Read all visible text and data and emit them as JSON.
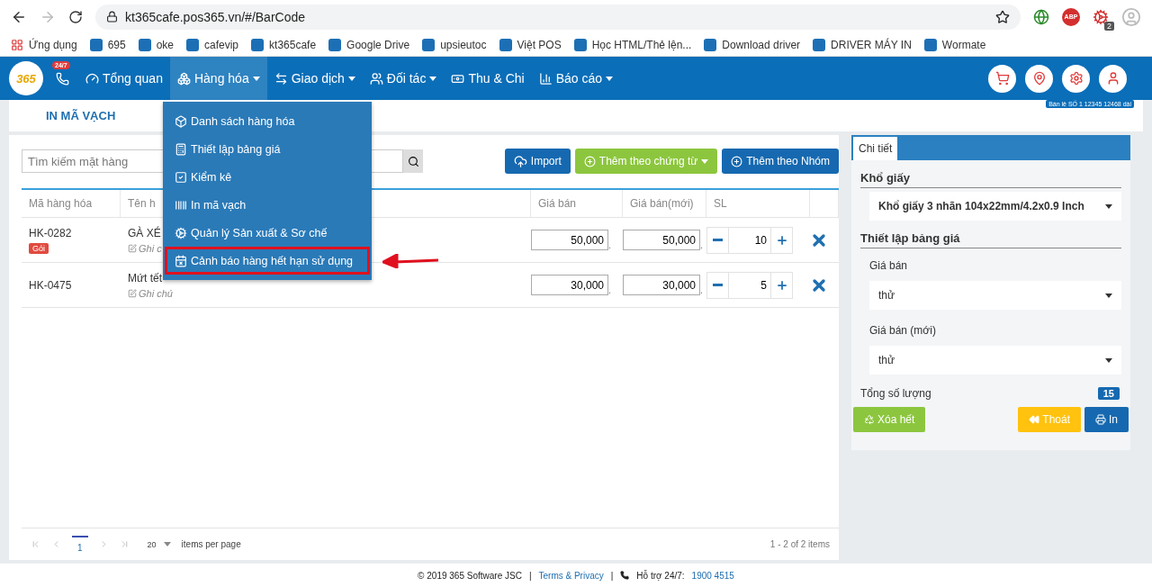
{
  "browser": {
    "url": "kt365cafe.pos365.vn/#/BarCode",
    "extension_badge": "2",
    "abp": "ABP",
    "bookmarks": [
      {
        "label": "Ứng dụng"
      },
      {
        "label": "695"
      },
      {
        "label": "oke"
      },
      {
        "label": "cafevip"
      },
      {
        "label": "kt365cafe"
      },
      {
        "label": "Google Drive"
      },
      {
        "label": "upsieutoc"
      },
      {
        "label": "Việt POS"
      },
      {
        "label": "Học HTML/Thẻ lện..."
      },
      {
        "label": "Download driver"
      },
      {
        "label": "DRIVER MÁY IN"
      },
      {
        "label": "Wormate"
      }
    ]
  },
  "nav": {
    "logo": "365",
    "hotline_badge": "24/7",
    "items": [
      {
        "label": "Tổng quan",
        "selected": false,
        "has_menu": false
      },
      {
        "label": "Hàng hóa",
        "selected": true,
        "has_menu": true
      },
      {
        "label": "Giao dịch",
        "selected": false,
        "has_menu": true
      },
      {
        "label": "Đối tác",
        "selected": false,
        "has_menu": true
      },
      {
        "label": "Thu & Chi",
        "selected": false,
        "has_menu": false
      },
      {
        "label": "Báo cáo",
        "selected": false,
        "has_menu": true
      }
    ],
    "branch": "Bán lẻ SỐ 1 12345 12468 dài"
  },
  "menu": [
    {
      "label": "Danh sách hàng hóa",
      "highlighted": false
    },
    {
      "label": "Thiết lập bảng giá",
      "highlighted": false
    },
    {
      "label": "Kiểm kê",
      "highlighted": false
    },
    {
      "label": "In mã vạch",
      "highlighted": false
    },
    {
      "label": "Quản lý Sản xuất & Sơ chế",
      "highlighted": false
    },
    {
      "label": "Cảnh báo hàng hết hạn sử dụng",
      "highlighted": true
    }
  ],
  "page_title": "IN MÃ VẠCH",
  "search": {
    "placeholder": "Tìm kiếm mặt hàng"
  },
  "actions": [
    {
      "label": "Import",
      "kind": "import"
    },
    {
      "label": "Thêm theo chứng từ",
      "kind": "dropdown"
    },
    {
      "label": "Thêm theo Nhóm",
      "kind": "add"
    }
  ],
  "table": {
    "decimal_mark": ".",
    "columns": [
      "Mã hàng hóa",
      "Tên h",
      "Giá bán",
      "Giá bán(mới)",
      "SL"
    ],
    "rows": [
      {
        "code": "HK-0282",
        "tag": "Gói",
        "name": "GÀ XÉ",
        "note": "Ghi c",
        "price": "50,000",
        "new_price": "50,000",
        "qty": "10"
      },
      {
        "code": "HK-0475",
        "name": "Mứt tết",
        "note": "Ghi chú",
        "price": "30,000",
        "new_price": "30,000",
        "qty": "5"
      }
    ]
  },
  "pager": {
    "pages": [
      {
        "label": "1",
        "selected": true
      }
    ],
    "page_size": "20",
    "page_size_label": "items per page",
    "summary": "1 - 2 of 2 items"
  },
  "detail": {
    "tab": "Chi tiết",
    "paper_heading": "Khổ giấy",
    "paper_value": "Khổ giấy 3 nhãn 104x22mm/4.2x0.9 Inch",
    "price_heading": "Thiết lập bảng giá",
    "price_label": "Giá bán",
    "price_value": "thử",
    "new_price_label": "Giá bán (mới)",
    "new_price_value": "thử",
    "total_label": "Tổng số lượng",
    "total": "15",
    "clear": "Xóa hết",
    "exit": "Thoát",
    "print": "In"
  },
  "footer": {
    "copyright": "© 2019 365 Software JSC",
    "sep1": "|",
    "terms": "Terms & Privacy",
    "sep2": "|",
    "support": "Hỗ trợ 24/7:",
    "phone": "1900 4515"
  }
}
